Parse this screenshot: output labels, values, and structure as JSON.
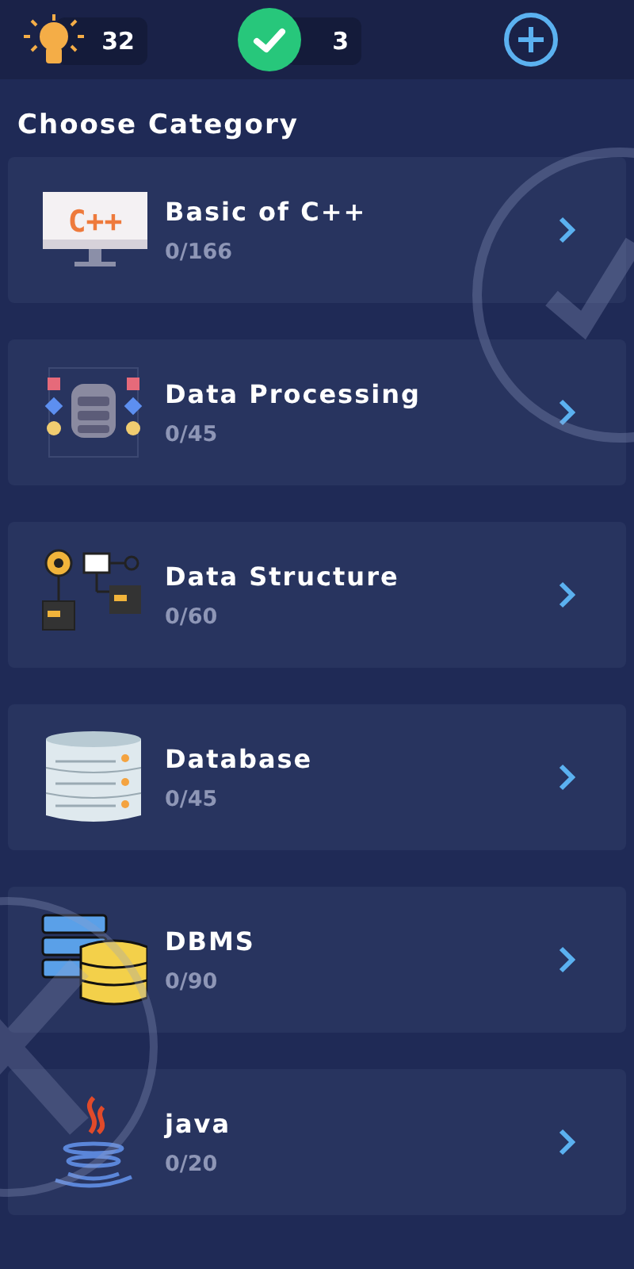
{
  "header": {
    "hints": "32",
    "solved": "3"
  },
  "title": "Choose Category",
  "categories": [
    {
      "kind": "cpp",
      "icon_label": "C++",
      "name": "Basic of C++",
      "progress": "0/166"
    },
    {
      "kind": "processing",
      "name": "Data Processing",
      "progress": "0/45"
    },
    {
      "kind": "structure",
      "name": "Data Structure",
      "progress": "0/60"
    },
    {
      "kind": "database",
      "name": "Database",
      "progress": "0/45"
    },
    {
      "kind": "dbms",
      "name": "DBMS",
      "progress": "0/90"
    },
    {
      "kind": "java",
      "name": "java",
      "progress": "0/20"
    }
  ]
}
